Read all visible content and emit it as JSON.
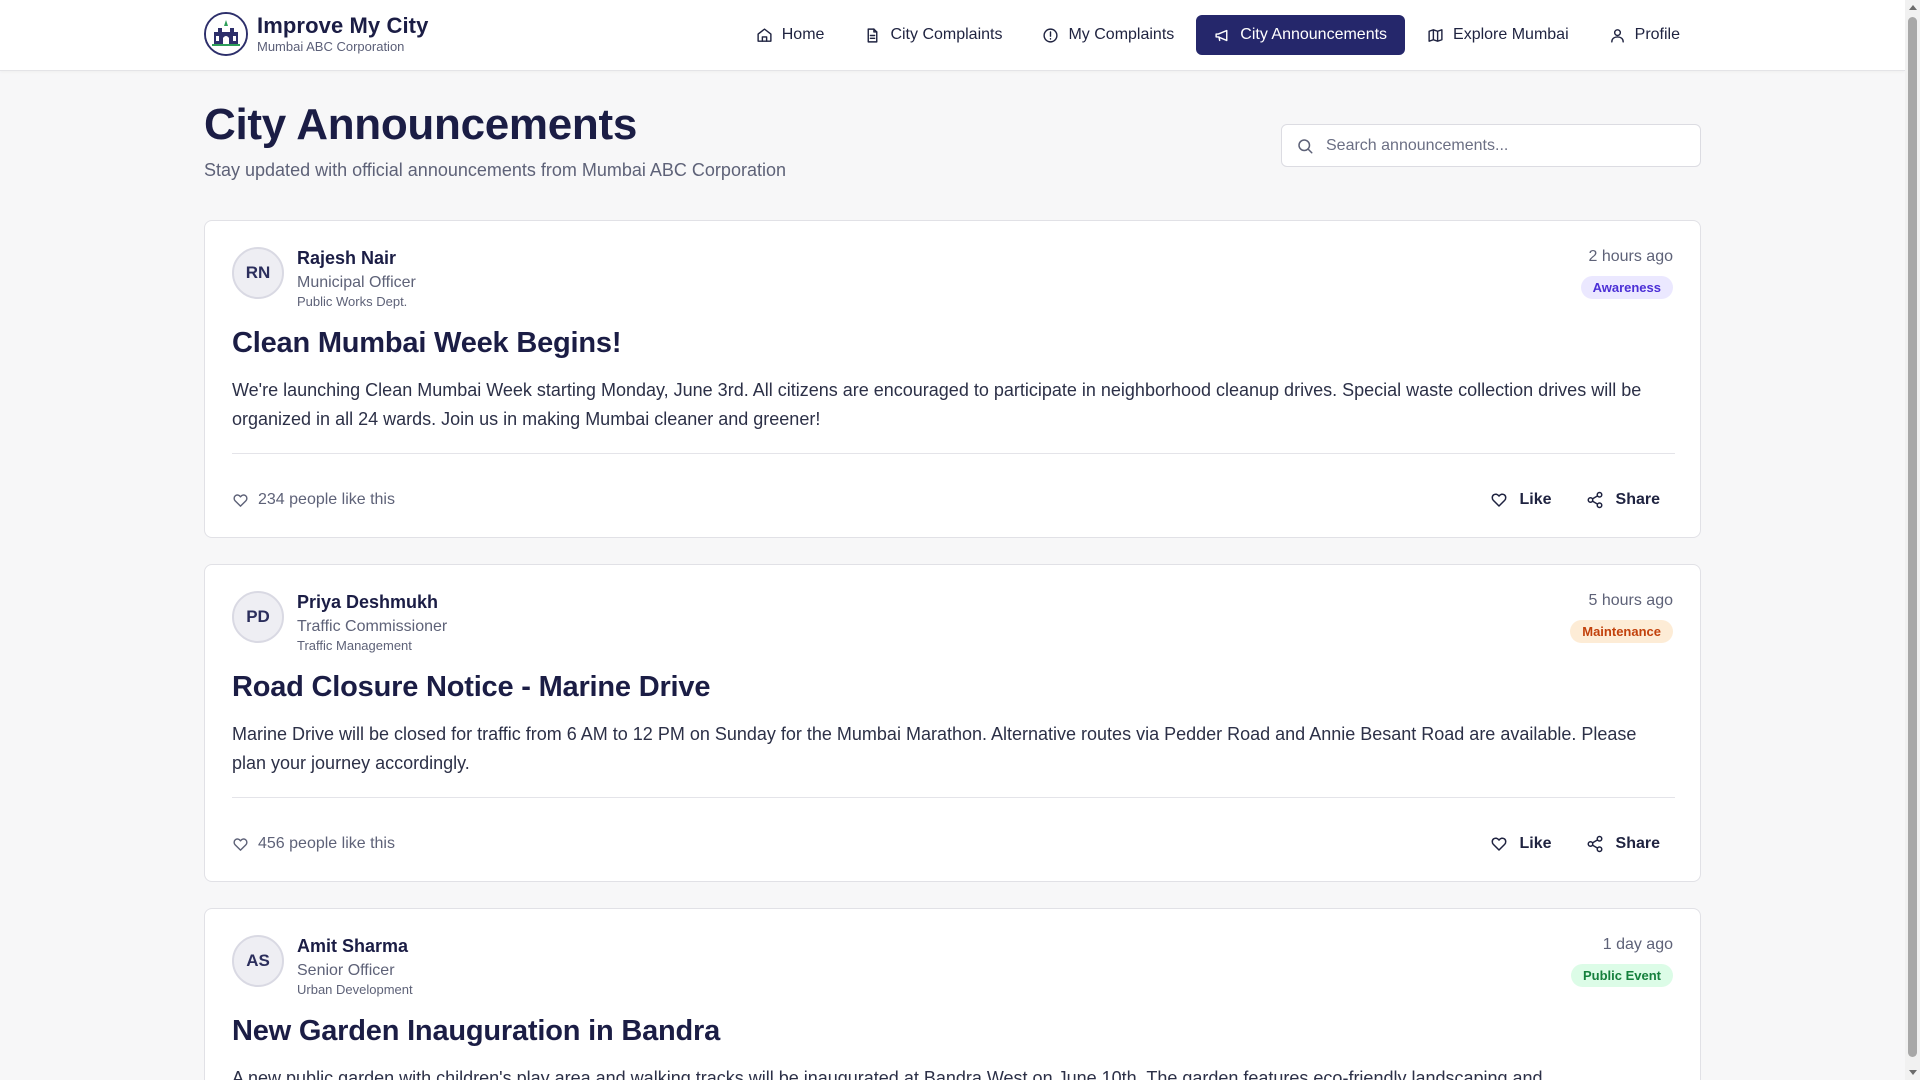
{
  "brand": {
    "title": "Improve My City",
    "subtitle": "Mumbai ABC Corporation"
  },
  "nav": {
    "items": [
      {
        "label": "Home",
        "icon": "home-icon"
      },
      {
        "label": "City Complaints",
        "icon": "document-icon"
      },
      {
        "label": "My Complaints",
        "icon": "alert-circle-icon"
      },
      {
        "label": "City Announcements",
        "icon": "megaphone-icon",
        "active": true
      },
      {
        "label": "Explore Mumbai",
        "icon": "map-icon"
      },
      {
        "label": "Profile",
        "icon": "user-icon"
      }
    ]
  },
  "page": {
    "title": "City Announcements",
    "subtitle": "Stay updated with official announcements from Mumbai ABC Corporation"
  },
  "search": {
    "placeholder": "Search announcements...",
    "value": ""
  },
  "announcements": [
    {
      "initials": "RN",
      "author": "Rajesh Nair",
      "role": "Municipal Officer",
      "department": "Public Works Dept.",
      "time": "2 hours ago",
      "category": "Awareness",
      "title": "Clean Mumbai Week Begins!",
      "body": "We're launching Clean Mumbai Week starting Monday, June 3rd. All citizens are encouraged to participate in neighborhood cleanup drives. Special waste collection drives will be organized in all 24 wards. Join us in making Mumbai cleaner and greener!",
      "likes_text": "234 people like this",
      "like_label": "Like",
      "share_label": "Share"
    },
    {
      "initials": "PD",
      "author": "Priya Deshmukh",
      "role": "Traffic Commissioner",
      "department": "Traffic Management",
      "time": "5 hours ago",
      "category": "Maintenance",
      "title": "Road Closure Notice - Marine Drive",
      "body": "Marine Drive will be closed for traffic from 6 AM to 12 PM on Sunday for the Mumbai Marathon. Alternative routes via Pedder Road and Annie Besant Road are available. Please plan your journey accordingly.",
      "likes_text": "456 people like this",
      "like_label": "Like",
      "share_label": "Share"
    },
    {
      "initials": "AS",
      "author": "Amit Sharma",
      "role": "Senior Officer",
      "department": "Urban Development",
      "time": "1 day ago",
      "category": "Public Event",
      "title": "New Garden Inauguration in Bandra",
      "body": "A new public garden with children's play area and walking tracks will be inaugurated at Bandra West on June 10th. The garden features eco-friendly landscaping and"
    }
  ],
  "colors": {
    "primary": "#25276b",
    "badge_awareness_bg": "#ebe8ff",
    "badge_awareness_fg": "#4b2fd6",
    "badge_maintenance_bg": "#fdecd6",
    "badge_maintenance_fg": "#c2410c",
    "badge_event_bg": "#dcfce7",
    "badge_event_fg": "#15803d"
  }
}
